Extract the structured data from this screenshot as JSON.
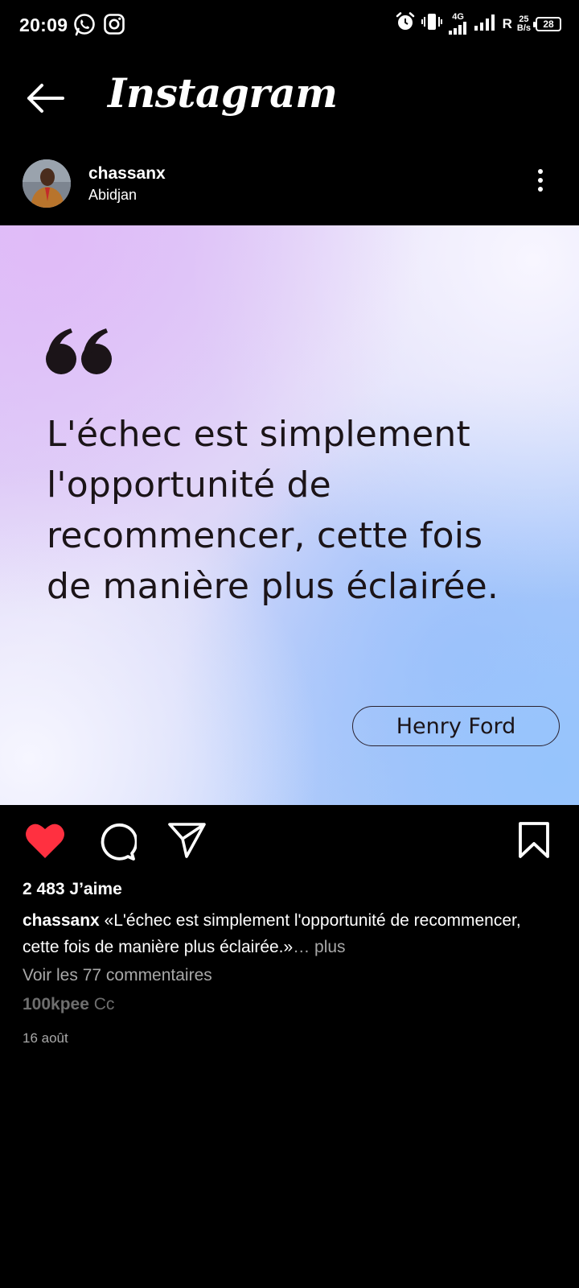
{
  "status_bar": {
    "time": "20:09",
    "network_label": "4G",
    "roaming": "R",
    "speed_value": "25",
    "speed_unit": "B/s",
    "battery": "28"
  },
  "header": {
    "title": "Instagram"
  },
  "post": {
    "username": "chassanx",
    "location": "Abidjan",
    "quote_line1": "L'échec est simplement",
    "quote_line2": "l'opportunité de",
    "quote_line3": "recommencer, cette fois",
    "quote_line4": "de manière plus éclairée.",
    "author": "Henry Ford",
    "likes": "2 483 J’aime",
    "caption_user": "chassanx",
    "caption_text": " «L'échec est simplement l'opportunité de recommencer, cette fois de manière plus éclairée.»",
    "caption_more": "… plus",
    "view_comments": "Voir les 77 commentaires",
    "comment_user": "100kpee",
    "comment_text": " Cc",
    "date": "16 août"
  },
  "colors": {
    "like_red": "#ff3040",
    "quote_text": "#1b1418",
    "muted_text": "#a8a8a8"
  },
  "icons": [
    "whatsapp-icon",
    "instagram-icon",
    "alarm-icon",
    "vibrate-icon",
    "signal-icon",
    "battery-icon",
    "back-arrow-icon",
    "more-vertical-icon",
    "heart-icon",
    "comment-icon",
    "share-icon",
    "bookmark-icon"
  ]
}
